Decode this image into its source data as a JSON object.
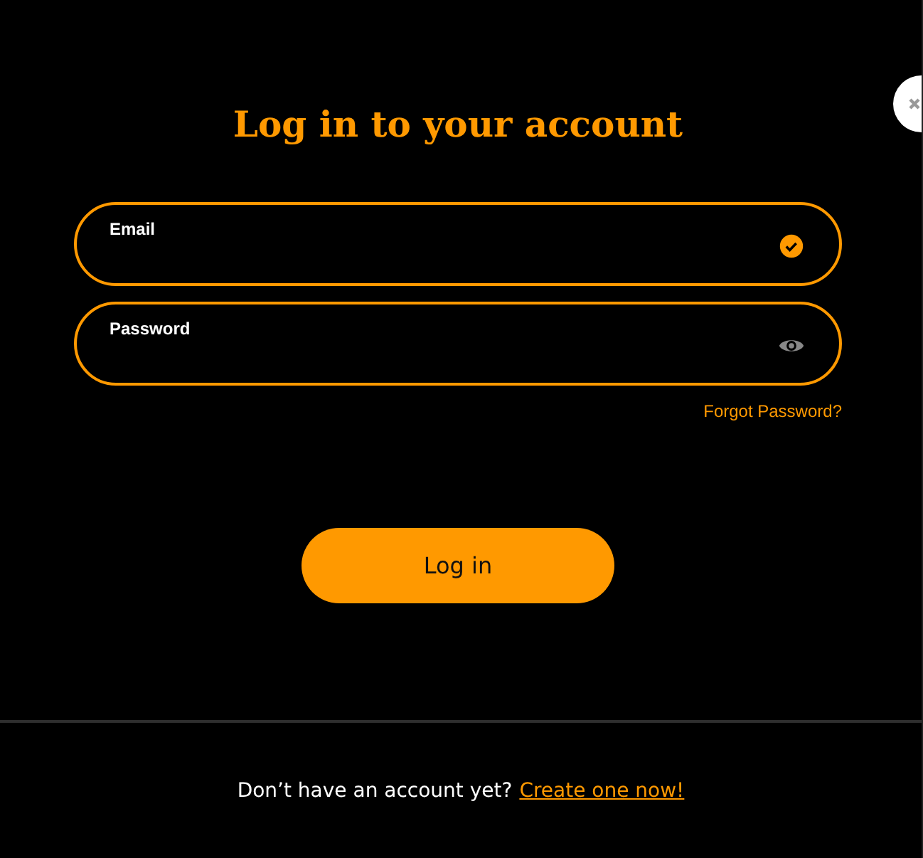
{
  "title": "Log in to your account",
  "fields": [
    {
      "label": "Email",
      "kind": "valid"
    },
    {
      "label": "Password",
      "kind": "reveal"
    }
  ],
  "forgot_link": "Forgot Password?",
  "login_button": "Log in",
  "footer": {
    "text": "Don’t have an account yet?",
    "link": "Create one now!"
  }
}
